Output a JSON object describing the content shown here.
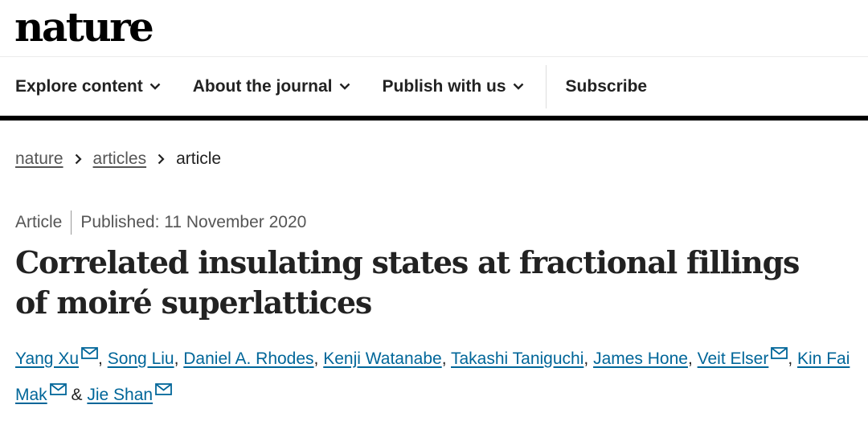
{
  "header": {
    "logo": "nature"
  },
  "nav": {
    "items": [
      {
        "label": "Explore content",
        "icon": "chevron-down-icon"
      },
      {
        "label": "About the journal",
        "icon": "chevron-down-icon"
      },
      {
        "label": "Publish with us",
        "icon": "chevron-down-icon"
      }
    ],
    "subscribe": "Subscribe"
  },
  "breadcrumb": [
    "nature",
    "articles",
    "article"
  ],
  "article": {
    "type": "Article",
    "published": "Published: 11 November 2020",
    "title": "Correlated insulating states at fractional fillings of moiré superlattices",
    "authors": [
      {
        "name": "Yang Xu",
        "email": true
      },
      {
        "name": "Song Liu",
        "email": false
      },
      {
        "name": "Daniel A. Rhodes",
        "email": false
      },
      {
        "name": "Kenji Watanabe",
        "email": false
      },
      {
        "name": "Takashi Taniguchi",
        "email": false
      },
      {
        "name": "James Hone",
        "email": false
      },
      {
        "name": "Veit Elser",
        "email": true
      },
      {
        "name": "Kin Fai Mak",
        "email": true
      },
      {
        "name": "Jie Shan",
        "email": true
      }
    ],
    "author_separator": ", ",
    "last_author_joiner": " & "
  },
  "colors": {
    "link": "#006699",
    "text": "#222222",
    "muted": "#555555"
  }
}
